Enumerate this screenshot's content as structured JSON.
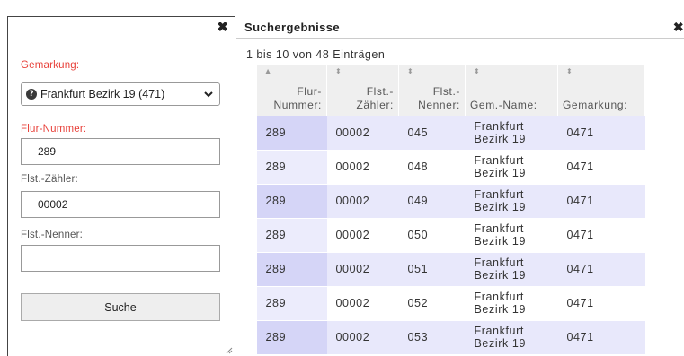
{
  "left": {
    "close": "✖",
    "gemarkung_label": "Gemarkung:",
    "gemarkung_value": "Frankfurt Bezirk 19 (471)",
    "flur_label": "Flur-Nummer:",
    "flur_value": "289",
    "zaehler_label": "Flst.-Zähler:",
    "zaehler_value": "00002",
    "nenner_label": "Flst.-Nenner:",
    "nenner_value": "",
    "search_button": "Suche"
  },
  "right": {
    "title": "Suchergebnisse",
    "close": "✖",
    "info": "1 bis 10 von 48 Einträgen",
    "columns": [
      {
        "label1": "Flur-",
        "label2": "Nummer:",
        "sort": "▲"
      },
      {
        "label1": "Flst.-",
        "label2": "Zähler:",
        "sort": "⬍"
      },
      {
        "label1": "Flst.-",
        "label2": "Nenner:",
        "sort": "⬍"
      },
      {
        "label1": "Gem.-Name:",
        "label2": "",
        "sort": "⬍"
      },
      {
        "label1": "Gemarkung:",
        "label2": "",
        "sort": "⬍"
      }
    ],
    "rows": [
      {
        "flur": "289",
        "zaehler": "00002",
        "nenner": "045",
        "name1": "Frankfurt",
        "name2": "Bezirk 19",
        "gemarkung": "0471"
      },
      {
        "flur": "289",
        "zaehler": "00002",
        "nenner": "048",
        "name1": "Frankfurt",
        "name2": "Bezirk 19",
        "gemarkung": "0471"
      },
      {
        "flur": "289",
        "zaehler": "00002",
        "nenner": "049",
        "name1": "Frankfurt",
        "name2": "Bezirk 19",
        "gemarkung": "0471"
      },
      {
        "flur": "289",
        "zaehler": "00002",
        "nenner": "050",
        "name1": "Frankfurt",
        "name2": "Bezirk 19",
        "gemarkung": "0471"
      },
      {
        "flur": "289",
        "zaehler": "00002",
        "nenner": "051",
        "name1": "Frankfurt",
        "name2": "Bezirk 19",
        "gemarkung": "0471"
      },
      {
        "flur": "289",
        "zaehler": "00002",
        "nenner": "052",
        "name1": "Frankfurt",
        "name2": "Bezirk 19",
        "gemarkung": "0471"
      },
      {
        "flur": "289",
        "zaehler": "00002",
        "nenner": "053",
        "name1": "Frankfurt",
        "name2": "Bezirk 19",
        "gemarkung": "0471"
      }
    ]
  }
}
